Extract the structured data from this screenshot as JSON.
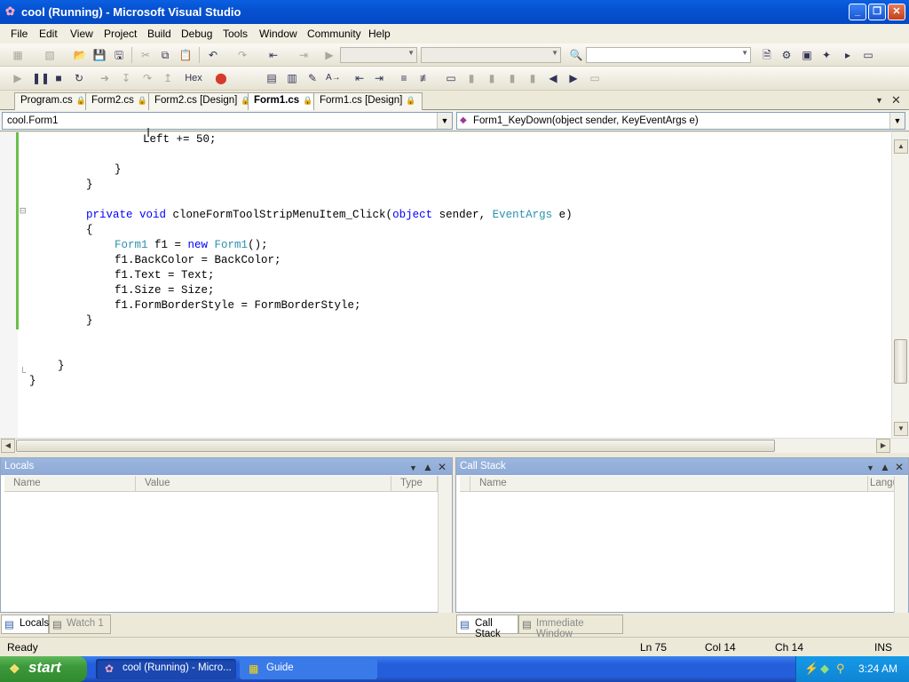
{
  "window": {
    "title": "cool (Running) - Microsoft Visual Studio"
  },
  "menu": [
    "File",
    "Edit",
    "View",
    "Project",
    "Build",
    "Debug",
    "Tools",
    "Window",
    "Community",
    "Help"
  ],
  "toolbar2": {
    "hex_label": "Hex"
  },
  "tabs": [
    {
      "label": "Program.cs",
      "active": false
    },
    {
      "label": "Form2.cs",
      "active": false
    },
    {
      "label": "Form2.cs [Design]",
      "active": false
    },
    {
      "label": "Form1.cs",
      "active": true
    },
    {
      "label": "Form1.cs [Design]",
      "active": false
    }
  ],
  "nav": {
    "class_combo": "cool.Form1",
    "member_combo": "Form1_KeyDown(object sender, KeyEventArgs e)"
  },
  "code": {
    "l0": "Left += 50;",
    "l2": "}",
    "l3": "}",
    "l5_kw": "private void",
    "l5_name": " cloneFormToolStripMenuItem_Click(",
    "l5_kw2": "object",
    "l5_mid": " sender, ",
    "l5_ty": "EventArgs",
    "l5_end": " e)",
    "l6": "{",
    "l7_ty": "Form1",
    "l7_mid": " f1 = ",
    "l7_kw": "new",
    "l7_ty2": " Form1",
    "l7_end": "();",
    "l8": "f1.BackColor = BackColor;",
    "l9": "f1.Text = Text;",
    "l10": "f1.Size = Size;",
    "l11": "f1.FormBorderStyle = FormBorderStyle;",
    "l12": "}",
    "l15": "}",
    "l16": "}"
  },
  "locals_panel": {
    "title": "Locals",
    "cols": [
      "Name",
      "Value",
      "Type"
    ]
  },
  "callstack_panel": {
    "title": "Call Stack",
    "cols": [
      "Name",
      "Langu"
    ]
  },
  "bottom_tabs_left": [
    "Locals",
    "Watch 1"
  ],
  "bottom_tabs_right": [
    "Call Stack",
    "Immediate Window"
  ],
  "status": {
    "text": "Ready",
    "ln": "Ln 75",
    "col": "Col 14",
    "ch": "Ch 14",
    "mode": "INS"
  },
  "taskbar": {
    "start": "start",
    "tasks": [
      "cool (Running) - Micro...",
      "Guide"
    ],
    "clock": "3:24 AM"
  }
}
